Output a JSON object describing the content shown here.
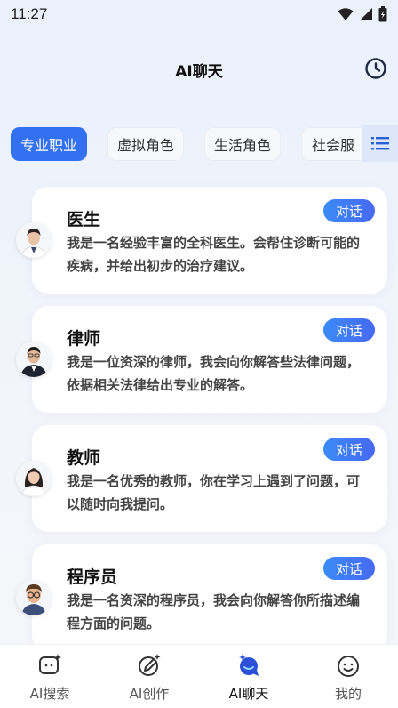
{
  "status_bar": {
    "time": "11:27"
  },
  "header": {
    "title": "AI聊天"
  },
  "tabs": [
    {
      "label": "专业职业",
      "active": true
    },
    {
      "label": "虚拟角色",
      "active": false
    },
    {
      "label": "生活角色",
      "active": false
    },
    {
      "label": "社会服",
      "active": false
    }
  ],
  "cards": [
    {
      "title": "医生",
      "description": "我是一名经验丰富的全科医生。会帮住诊断可能的疾病，并给出初步的治疗建议。",
      "button": "对话"
    },
    {
      "title": "律师",
      "description": "我是一位资深的律师，我会向你解答些法律问题，依据相关法律给出专业的解答。",
      "button": "对话"
    },
    {
      "title": "教师",
      "description": "我是一名优秀的教师，你在学习上遇到了问题，可以随时向我提问。",
      "button": "对话"
    },
    {
      "title": "程序员",
      "description": "我是一名资深的程序员，我会向你解答你所描述编程方面的问题。",
      "button": "对话"
    }
  ],
  "bottom_nav": [
    {
      "label": "AI搜索",
      "icon": "sparkle-chat-icon"
    },
    {
      "label": "AI创作",
      "icon": "pen-sparkle-icon"
    },
    {
      "label": "AI聊天",
      "icon": "chat-bubble-icon",
      "active": true
    },
    {
      "label": "我的",
      "icon": "smiley-icon"
    }
  ],
  "colors": {
    "accent": "#3370f2",
    "button_gradient_start": "#3b8af7",
    "button_gradient_end": "#4669f2"
  }
}
